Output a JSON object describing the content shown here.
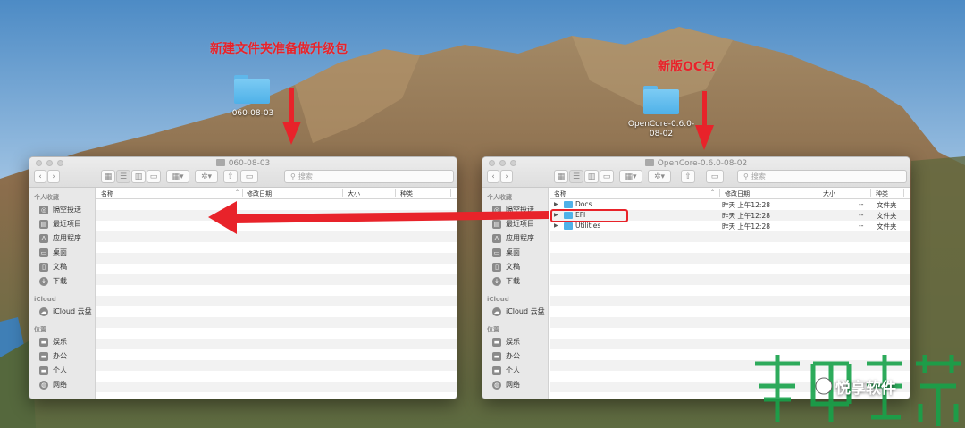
{
  "desktop": {
    "annotation_left": "新建文件夹准备做升级包",
    "annotation_right": "新版OC包",
    "folder_left_label": "060-08-03",
    "folder_right_label": "OpenCore-0.6.0-08-02",
    "accent_color": "#e8232a"
  },
  "left_window": {
    "title": "060-08-03",
    "search_placeholder": "搜索",
    "columns": {
      "name": "名称",
      "date": "修改日期",
      "size": "大小",
      "kind": "种类"
    },
    "rows": []
  },
  "right_window": {
    "title": "OpenCore-0.6.0-08-02",
    "search_placeholder": "搜索",
    "columns": {
      "name": "名称",
      "date": "修改日期",
      "size": "大小",
      "kind": "种类"
    },
    "rows": [
      {
        "name": "Docs",
        "date": "昨天 上午12:28",
        "size": "--",
        "kind": "文件夹"
      },
      {
        "name": "EFI",
        "date": "昨天 上午12:28",
        "size": "--",
        "kind": "文件夹"
      },
      {
        "name": "Utilities",
        "date": "昨天 上午12:28",
        "size": "--",
        "kind": "文件夹"
      }
    ]
  },
  "sidebar": {
    "favorites_header": "个人收藏",
    "favorites": [
      {
        "label": "隔空投送",
        "icon": "airdrop-icon"
      },
      {
        "label": "最近项目",
        "icon": "recents-icon"
      },
      {
        "label": "应用程序",
        "icon": "applications-icon"
      },
      {
        "label": "桌面",
        "icon": "desktop-icon"
      },
      {
        "label": "文稿",
        "icon": "documents-icon"
      },
      {
        "label": "下载",
        "icon": "downloads-icon"
      }
    ],
    "icloud_header": "iCloud",
    "icloud": [
      {
        "label": "iCloud 云盘",
        "icon": "cloud-icon"
      }
    ],
    "locations_header": "位置",
    "locations": [
      {
        "label": "娱乐",
        "icon": "disk-icon"
      },
      {
        "label": "办公",
        "icon": "disk-icon"
      },
      {
        "label": "个人",
        "icon": "disk-icon"
      },
      {
        "label": "网络",
        "icon": "network-icon"
      }
    ]
  },
  "watermark": {
    "text": "悦享软件"
  }
}
